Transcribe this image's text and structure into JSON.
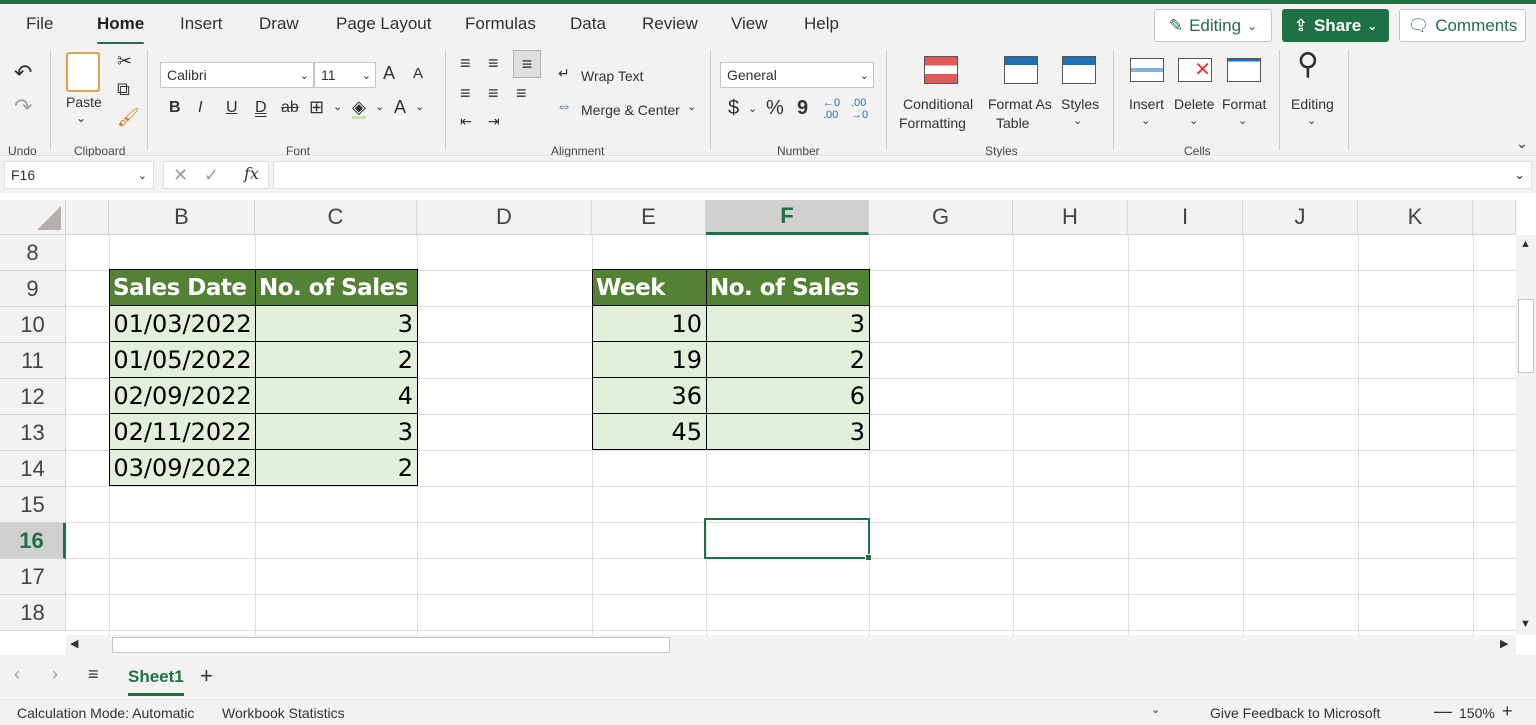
{
  "menu": {
    "tabs": [
      "File",
      "Home",
      "Insert",
      "Draw",
      "Page Layout",
      "Formulas",
      "Data",
      "Review",
      "View",
      "Help"
    ],
    "active_tab": "Home",
    "editing_label": "Editing",
    "share_label": "Share",
    "comments_label": "Comments"
  },
  "ribbon": {
    "undo_group": "Undo",
    "clipboard": {
      "paste_label": "Paste",
      "group": "Clipboard"
    },
    "font": {
      "name": "Calibri",
      "size": "11",
      "group": "Font",
      "bold": "B",
      "italic": "I",
      "underline": "U",
      "double_underline": "D",
      "strike": "ab",
      "grow": "A",
      "shrink": "A",
      "color": "A"
    },
    "alignment": {
      "wrap_text": "Wrap Text",
      "merge_center": "Merge & Center",
      "group": "Alignment"
    },
    "number": {
      "format": "General",
      "group": "Number",
      "currency": "$",
      "percent": "%",
      "comma": "9",
      "inc_decimal_top": "←0",
      "inc_decimal_bottom": ".00",
      "dec_decimal_top": ".00",
      "dec_decimal_bottom": "→0"
    },
    "styles": {
      "conditional_1": "Conditional",
      "conditional_2": "Formatting",
      "format_table_1": "Format As",
      "format_table_2": "Table",
      "styles": "Styles",
      "group": "Styles"
    },
    "cells": {
      "insert": "Insert",
      "delete": "Delete",
      "format": "Format",
      "group": "Cells"
    },
    "editing": {
      "label": "Editing"
    }
  },
  "formula_bar": {
    "name_box": "F16",
    "fx": "fx",
    "value": ""
  },
  "columns": [
    "B",
    "C",
    "D",
    "E",
    "F",
    "G",
    "H",
    "I",
    "J",
    "K"
  ],
  "selected_column": "F",
  "rows": [
    "8",
    "9",
    "10",
    "11",
    "12",
    "13",
    "14",
    "15",
    "16",
    "17",
    "18"
  ],
  "selected_row": "16",
  "table1": {
    "headers": [
      "Sales Date",
      "No. of Sales"
    ],
    "rows": [
      [
        "01/03/2022",
        "3"
      ],
      [
        "01/05/2022",
        "2"
      ],
      [
        "02/09/2022",
        "4"
      ],
      [
        "02/11/2022",
        "3"
      ],
      [
        "03/09/2022",
        "2"
      ]
    ]
  },
  "table2": {
    "headers": [
      "Week",
      "No. of Sales"
    ],
    "rows": [
      [
        "10",
        "3"
      ],
      [
        "19",
        "2"
      ],
      [
        "36",
        "6"
      ],
      [
        "45",
        "3"
      ]
    ]
  },
  "sheets": {
    "active": "Sheet1"
  },
  "status_bar": {
    "calc_mode": "Calculation Mode: Automatic",
    "workbook_stats": "Workbook Statistics",
    "feedback": "Give Feedback to Microsoft",
    "zoom": "150%"
  },
  "colors": {
    "accent": "#1e7145",
    "header_fill": "#548235",
    "data_fill": "#e2efda"
  }
}
